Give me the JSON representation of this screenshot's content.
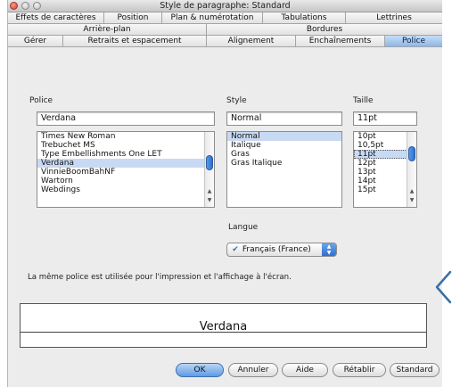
{
  "window": {
    "title": "Style de paragraphe: Standard"
  },
  "tabs_row1": [
    "Effets de caractères",
    "Position",
    "Plan & numérotation",
    "Tabulations",
    "Lettrines"
  ],
  "tabs_row2": [
    "Arrière-plan",
    "Bordures"
  ],
  "tabs_row3": [
    "Gérer",
    "Retraits et espacement",
    "Alignement",
    "Enchaînements",
    "Police"
  ],
  "active_tab": "Police",
  "font": {
    "label": "Police",
    "value": "Verdana",
    "items": [
      "Times New Roman",
      "Trebuchet MS",
      "Type Embellishments One LET",
      "Verdana",
      "VinnieBoomBahNF",
      "Wartorn",
      "Webdings"
    ],
    "selected_index": 3
  },
  "style": {
    "label": "Style",
    "value": "Normal",
    "items": [
      "Normal",
      "Italique",
      "Gras",
      "Gras Italique"
    ],
    "selected_index": 0
  },
  "size": {
    "label": "Taille",
    "value": "11pt",
    "items": [
      "10pt",
      "10,5pt",
      "11pt",
      "12pt",
      "13pt",
      "14pt",
      "15pt"
    ],
    "selected_index": 2
  },
  "language": {
    "label": "Langue",
    "value": "Français (France)",
    "icon": "spellcheck-flag-icon"
  },
  "info_text": "La même police est utilisée pour l'impression et l'affichage à l'écran.",
  "preview": {
    "text": "Verdana"
  },
  "buttons": {
    "ok": "OK",
    "cancel": "Annuler",
    "help": "Aide",
    "reset": "Rétablir",
    "standard": "Standard"
  },
  "colors": {
    "active_tab": "#8cb7e8",
    "selection": "#c8daf3",
    "default_button": "#5e9be3",
    "chevron": "#3b6ea5"
  }
}
